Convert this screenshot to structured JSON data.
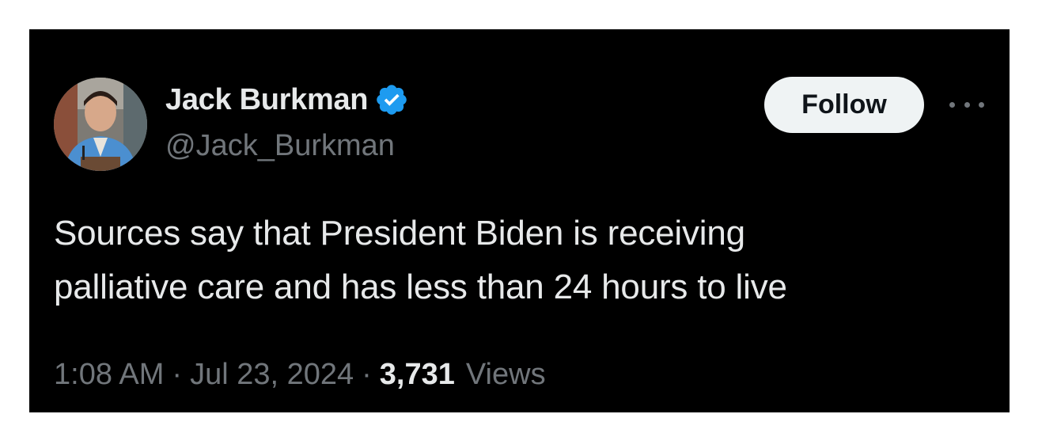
{
  "tweet": {
    "author": {
      "display_name": "Jack Burkman",
      "handle": "@Jack_Burkman",
      "verified": true,
      "verified_icon": "verified-badge-icon",
      "verified_color": "#1d9bf0"
    },
    "follow_label": "Follow",
    "more_icon": "more-horizontal-icon",
    "text_lines": [
      "Sources say that President Biden is receiving",
      "palliative care and has less than 24 hours to live"
    ],
    "time": "1:08 AM",
    "separator": "·",
    "date": "Jul 23, 2024",
    "views_count": "3,731",
    "views_label": "Views"
  },
  "colors": {
    "card_background": "#000000",
    "primary_text": "#e7e9ea",
    "secondary_text": "#71767b",
    "follow_button_bg": "#eff3f4",
    "follow_button_text": "#0f1419"
  }
}
